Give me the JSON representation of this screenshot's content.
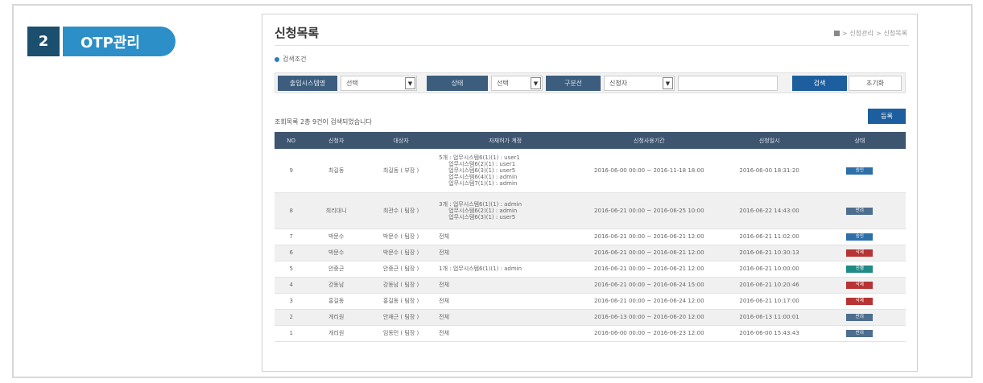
{
  "section": {
    "number": "2",
    "label": "OTP관리"
  },
  "page": {
    "title": "신청목록",
    "breadcrumb": [
      "신청관리",
      "신청목록"
    ]
  },
  "search": {
    "header": "검색조건",
    "filters": [
      {
        "label": "출입시스템명",
        "value": "선택"
      },
      {
        "label": "상태",
        "value": "선택"
      },
      {
        "label": "구분선",
        "value": "신청자"
      }
    ],
    "text_value": "",
    "search_button": "검색",
    "reset_button": "초기화"
  },
  "results": {
    "summary": "조회목록 2총 9건이 검색되었습니다",
    "add_button": "등록",
    "columns": [
      "NO",
      "신청자",
      "대상자",
      "자재허가 계정",
      "신청사용기간",
      "신청일시",
      "상태"
    ],
    "rows": [
      {
        "no": "9",
        "applicant": "최길동",
        "target": "최길동 ( 부장 )",
        "accounts": [
          "5개 : 업무시스템6(1)(1) : user1",
          "업무시스템6(2)(1) : user1",
          "업무시스템6(3)(1) : user5",
          "업무시스템6(4)(1) : admin",
          "업무시스템7(1)(1) : admin"
        ],
        "period": "2016-06-00 00:00 ~ 2016-11-18 18:00",
        "date": "2016-06-00 18:31:20",
        "status": "승인",
        "status_color": "#2d6fa8"
      },
      {
        "no": "8",
        "applicant": "최리대니",
        "target": "최관수 ( 팀장 )",
        "accounts": [
          "3개 : 업무시스템6(1)(1) : admin",
          "업무시스템6(2)(1) : admin",
          "업무시스템6(3)(1) : user5"
        ],
        "period": "2016-06-21 00:00 ~ 2016-06-25 10:00",
        "date": "2016-06-22 14:43:00",
        "status": "반려",
        "status_color": "#4d6e8e"
      },
      {
        "no": "7",
        "applicant": "박문수",
        "target": "박문수 ( 팀장 )",
        "accounts": [
          "전체"
        ],
        "period": "2016-06-21 00:00 ~ 2016-06-21 12:00",
        "date": "2016-06-21 11:02:00",
        "status": "승인",
        "status_color": "#2d6fa8"
      },
      {
        "no": "6",
        "applicant": "박문수",
        "target": "박문수 ( 팀장 )",
        "accounts": [
          "전체"
        ],
        "period": "2016-06-21 00:00 ~ 2016-06-21 12:00",
        "date": "2016-06-21 10:30:13",
        "status": "삭제",
        "status_color": "#b83333"
      },
      {
        "no": "5",
        "applicant": "안중근",
        "target": "안중근 ( 팀장 )",
        "accounts": [
          "1개 : 업무시스템6(1)(1) : admin"
        ],
        "period": "2016-06-21 00:00 ~ 2016-06-21 12:00",
        "date": "2016-06-21 10:00:00",
        "status": "진행",
        "status_color": "#1f8a86"
      },
      {
        "no": "4",
        "applicant": "강동남",
        "target": "강동남 ( 팀장 )",
        "accounts": [
          "전체"
        ],
        "period": "2016-06-21 00:00 ~ 2016-06-24 15:00",
        "date": "2016-06-21 10:20:46",
        "status": "삭제",
        "status_color": "#b83333"
      },
      {
        "no": "3",
        "applicant": "홍길동",
        "target": "홍길동 ( 팀장 )",
        "accounts": [
          "전체"
        ],
        "period": "2016-06-21 00:00 ~ 2016-06-24 12:00",
        "date": "2016-06-21 10:17:00",
        "status": "삭제",
        "status_color": "#b83333"
      },
      {
        "no": "2",
        "applicant": "개리원",
        "target": "안재근 ( 팀장 )",
        "accounts": [
          "전체"
        ],
        "period": "2016-06-13 00:00 ~ 2016-06-20 12:00",
        "date": "2016-06-13 11:00:01",
        "status": "반려",
        "status_color": "#4d6e8e"
      },
      {
        "no": "1",
        "applicant": "개리원",
        "target": "임동민 ( 팀장 )",
        "accounts": [
          "전체"
        ],
        "period": "2016-06-00 00:00 ~ 2016-06-23 12:00",
        "date": "2016-06-00 15:43:43",
        "status": "반려",
        "status_color": "#4d6e8e"
      }
    ]
  }
}
